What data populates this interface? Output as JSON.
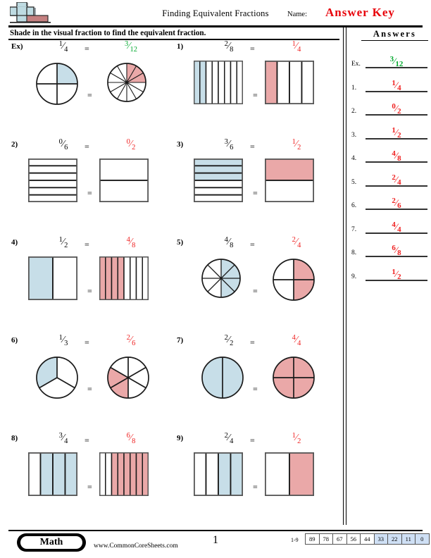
{
  "header": {
    "title": "Finding Equivalent Fractions",
    "name_label": "Name:",
    "answer_key": "Answer Key",
    "logo_name": "commoncoresheets-logo"
  },
  "instructions": "Shade in the visual fraction to find the equivalent fraction.",
  "answers_panel": {
    "title": "Answers",
    "rows": [
      {
        "num": "Ex.",
        "numerator": "3",
        "denominator": "12",
        "color": "green"
      },
      {
        "num": "1.",
        "numerator": "1",
        "denominator": "4",
        "color": "red"
      },
      {
        "num": "2.",
        "numerator": "0",
        "denominator": "2",
        "color": "red"
      },
      {
        "num": "3.",
        "numerator": "1",
        "denominator": "2",
        "color": "red"
      },
      {
        "num": "4.",
        "numerator": "4",
        "denominator": "8",
        "color": "red"
      },
      {
        "num": "5.",
        "numerator": "2",
        "denominator": "4",
        "color": "red"
      },
      {
        "num": "6.",
        "numerator": "2",
        "denominator": "6",
        "color": "red"
      },
      {
        "num": "7.",
        "numerator": "4",
        "denominator": "4",
        "color": "red"
      },
      {
        "num": "8.",
        "numerator": "6",
        "denominator": "8",
        "color": "red"
      },
      {
        "num": "9.",
        "numerator": "1",
        "denominator": "2",
        "color": "red"
      }
    ]
  },
  "equals_sign": "=",
  "colors": {
    "shade_blue": "#c7dee8",
    "shade_red": "#eaa8a8",
    "answer_green": "#00a82d",
    "answer_red": "#ef2020",
    "stroke": "#1a1a1a"
  },
  "problems": [
    {
      "label": "Ex)",
      "left": {
        "numerator": "1",
        "denominator": "4",
        "shape": "circle",
        "parts": 4,
        "shaded": 1
      },
      "right": {
        "numerator": "3",
        "denominator": "12",
        "shape": "circle",
        "parts": 12,
        "shaded": 3,
        "answer_color": "green"
      }
    },
    {
      "label": "1)",
      "left": {
        "numerator": "2",
        "denominator": "8",
        "shape": "bar-vertical",
        "parts": 8,
        "shaded": 2,
        "shaded_from": "start"
      },
      "right": {
        "numerator": "1",
        "denominator": "4",
        "shape": "bar-vertical",
        "parts": 4,
        "shaded": 1,
        "shaded_from": "start",
        "answer_color": "red"
      }
    },
    {
      "label": "2)",
      "left": {
        "numerator": "0",
        "denominator": "6",
        "shape": "bar-horizontal",
        "parts": 6,
        "shaded": 0,
        "shaded_from": "start"
      },
      "right": {
        "numerator": "0",
        "denominator": "2",
        "shape": "bar-horizontal",
        "parts": 2,
        "shaded": 0,
        "shaded_from": "start",
        "answer_color": "red"
      }
    },
    {
      "label": "3)",
      "left": {
        "numerator": "3",
        "denominator": "6",
        "shape": "bar-horizontal",
        "parts": 6,
        "shaded": 3,
        "shaded_from": "start"
      },
      "right": {
        "numerator": "1",
        "denominator": "2",
        "shape": "bar-horizontal",
        "parts": 2,
        "shaded": 1,
        "shaded_from": "start",
        "answer_color": "red"
      }
    },
    {
      "label": "4)",
      "left": {
        "numerator": "1",
        "denominator": "2",
        "shape": "bar-vertical",
        "parts": 2,
        "shaded": 1,
        "shaded_from": "start"
      },
      "right": {
        "numerator": "4",
        "denominator": "8",
        "shape": "bar-vertical",
        "parts": 8,
        "shaded": 4,
        "shaded_from": "start",
        "answer_color": "red"
      }
    },
    {
      "label": "5)",
      "left": {
        "numerator": "4",
        "denominator": "8",
        "shape": "circle",
        "parts": 8,
        "shaded": 4
      },
      "right": {
        "numerator": "2",
        "denominator": "4",
        "shape": "circle",
        "parts": 4,
        "shaded": 2,
        "answer_color": "red"
      }
    },
    {
      "label": "6)",
      "left": {
        "numerator": "1",
        "denominator": "3",
        "shape": "circle",
        "parts": 3,
        "shaded": 1
      },
      "right": {
        "numerator": "2",
        "denominator": "6",
        "shape": "circle",
        "parts": 6,
        "shaded": 2,
        "answer_color": "red"
      }
    },
    {
      "label": "7)",
      "left": {
        "numerator": "2",
        "denominator": "2",
        "shape": "circle",
        "parts": 2,
        "shaded": 2
      },
      "right": {
        "numerator": "4",
        "denominator": "4",
        "shape": "circle",
        "parts": 4,
        "shaded": 4,
        "answer_color": "red"
      }
    },
    {
      "label": "8)",
      "left": {
        "numerator": "3",
        "denominator": "4",
        "shape": "bar-vertical",
        "parts": 4,
        "shaded": 3,
        "shaded_from": "end"
      },
      "right": {
        "numerator": "6",
        "denominator": "8",
        "shape": "bar-vertical",
        "parts": 8,
        "shaded": 6,
        "shaded_from": "end",
        "answer_color": "red"
      }
    },
    {
      "label": "9)",
      "left": {
        "numerator": "2",
        "denominator": "4",
        "shape": "bar-vertical",
        "parts": 4,
        "shaded": 2,
        "shaded_from": "end"
      },
      "right": {
        "numerator": "1",
        "denominator": "2",
        "shape": "bar-vertical",
        "parts": 2,
        "shaded": 1,
        "shaded_from": "end",
        "answer_color": "red"
      }
    }
  ],
  "footer": {
    "subject_badge": "Math",
    "site_url": "www.CommonCoreSheets.com",
    "page_number": "1",
    "score_label": "1-9",
    "score_cells": [
      {
        "value": "89",
        "highlighted": false
      },
      {
        "value": "78",
        "highlighted": false
      },
      {
        "value": "67",
        "highlighted": false
      },
      {
        "value": "56",
        "highlighted": false
      },
      {
        "value": "44",
        "highlighted": false
      },
      {
        "value": "33",
        "highlighted": true
      },
      {
        "value": "22",
        "highlighted": true
      },
      {
        "value": "11",
        "highlighted": true
      },
      {
        "value": "0",
        "highlighted": true
      }
    ]
  }
}
